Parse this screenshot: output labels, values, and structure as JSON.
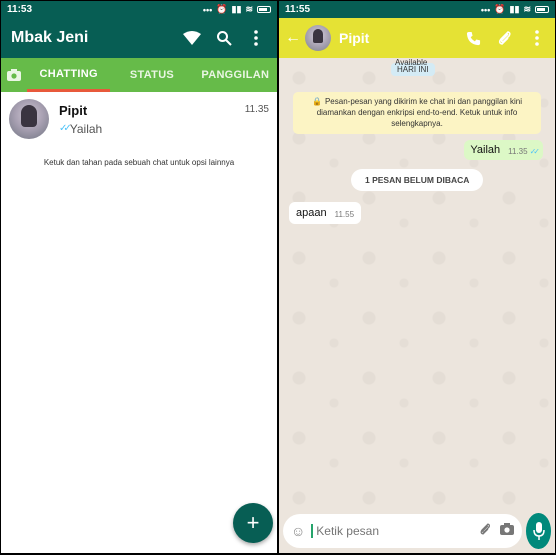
{
  "left": {
    "status": {
      "time": "11:53",
      "icons": "... ⏰ ▮▮ ▮▮"
    },
    "header": {
      "title": "Mbak Jeni",
      "icons": [
        "wifi-icon",
        "search-icon",
        "more-vert-icon"
      ]
    },
    "tabs": {
      "camera_icon": "camera-icon",
      "items": [
        "CHATTING",
        "STATUS",
        "PANGGILAN"
      ],
      "active": "CHATTING"
    },
    "chats": [
      {
        "name": "Pipit",
        "last_message": "Yailah",
        "time": "11.35"
      }
    ],
    "hint": "Ketuk dan tahan pada sebuah chat untuk opsi lainnya",
    "fab_label": "+"
  },
  "right": {
    "status": {
      "time": "11:55",
      "icons": "... ⏰ ▮▮ ▮▮"
    },
    "header": {
      "back": "←",
      "title": "Pipit",
      "icons": [
        "phone-icon",
        "attach-icon",
        "more-vert-icon"
      ]
    },
    "availability": "Available",
    "date_chip": "HARI INI",
    "e2e_notice": "Pesan-pesan yang dikirim ke chat ini dan panggilan kini diamankan dengan enkripsi end-to-end. Ketuk untuk info selengkapnya.",
    "outgoing": {
      "text": "Yailah",
      "time": "11.35"
    },
    "unread_banner": "1 PESAN BELUM DIBACA",
    "incoming": {
      "text": "apaan",
      "time": "11.55"
    },
    "composer": {
      "placeholder": "Ketik pesan"
    }
  },
  "colors": {
    "primary": "#075e54",
    "tab_green": "#66bb49",
    "chat_header_yellow": "#e5e234",
    "accent": "#e8593b",
    "bubble_out": "#dcf8c6",
    "tick_blue": "#4fc3f7"
  }
}
